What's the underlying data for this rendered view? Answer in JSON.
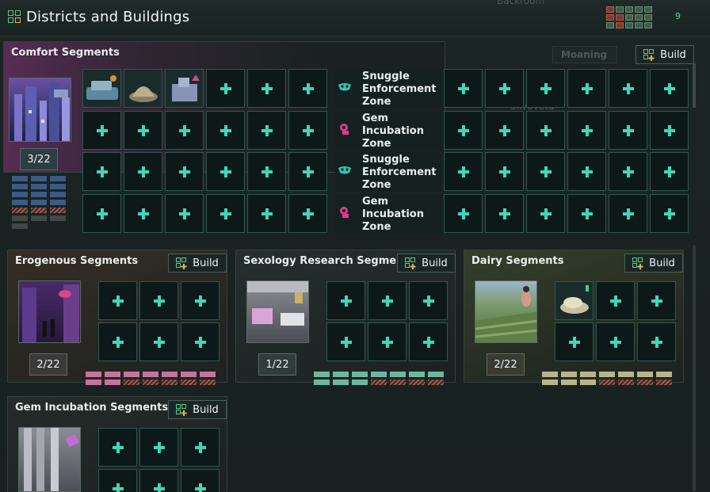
{
  "window": {
    "title": "Districts and Buildings",
    "ghost_top": "Backroom",
    "ghost_tab": "Moaning",
    "ghost_mid": "Silvoveta",
    "header_count": "9"
  },
  "comfort": {
    "title": "Comfort Segments",
    "build_label": "Build",
    "count": "3/22",
    "zones": [
      {
        "label": "Snuggle Enforcement Zone",
        "icon": "mask-icon"
      },
      {
        "label": "Gem Incubation Zone",
        "icon": "gem-incubator-icon"
      },
      {
        "label": "Snuggle Enforcement Zone",
        "icon": "mask-icon"
      },
      {
        "label": "Gem Incubation Zone",
        "icon": "gem-incubator-icon"
      }
    ]
  },
  "erogenous": {
    "title": "Erogenous Segments",
    "build_label": "Build",
    "count": "2/22"
  },
  "sexology": {
    "title": "Sexology Research Segments",
    "build_label": "Build",
    "count": "1/22"
  },
  "dairy": {
    "title": "Dairy Segments",
    "build_label": "Build",
    "count": "2/22"
  },
  "gem": {
    "title": "Gem Incubation Segments",
    "build_label": "Build"
  },
  "colors": {
    "slot_plus": "#41d6bd",
    "comfort_tint": "#6b2f63",
    "erogenous_bar": "#c7749a",
    "sexology_bar": "#6fb79c",
    "dairy_bar": "#b9b48a",
    "hatched_bar": "#a5584a"
  }
}
